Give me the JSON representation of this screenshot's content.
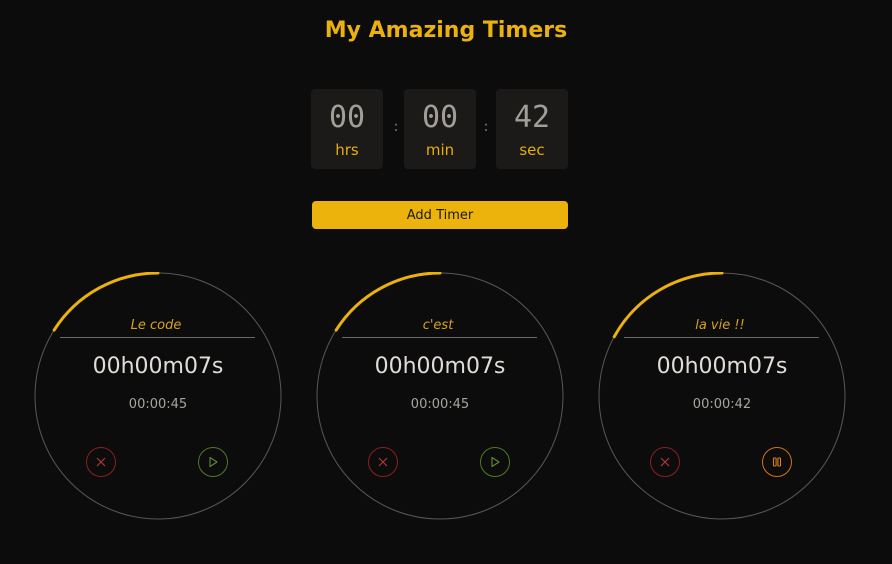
{
  "app": {
    "title": "My Amazing Timers"
  },
  "time_input": {
    "hours": "00",
    "hours_unit": "hrs",
    "minutes": "00",
    "minutes_unit": "min",
    "seconds": "42",
    "seconds_unit": "sec",
    "separator": ":"
  },
  "add_button": {
    "label": "Add Timer"
  },
  "colors": {
    "accent": "#ebb10d",
    "background": "#0d0c0c",
    "delete": "#b33a3a",
    "play": "#5f8f2f",
    "pause": "#e07d1c"
  },
  "timers": [
    {
      "label": "Le code",
      "remaining": "00h00m07s",
      "total": "00:00:45",
      "progress": 0.16,
      "state": "paused",
      "delete_icon": "close-icon",
      "action_icon": "play-icon"
    },
    {
      "label": "c'est",
      "remaining": "00h00m07s",
      "total": "00:00:45",
      "progress": 0.16,
      "state": "paused",
      "delete_icon": "close-icon",
      "action_icon": "play-icon"
    },
    {
      "label": "la vie !!",
      "remaining": "00h00m07s",
      "total": "00:00:42",
      "progress": 0.17,
      "state": "running",
      "delete_icon": "close-icon",
      "action_icon": "pause-icon"
    }
  ]
}
